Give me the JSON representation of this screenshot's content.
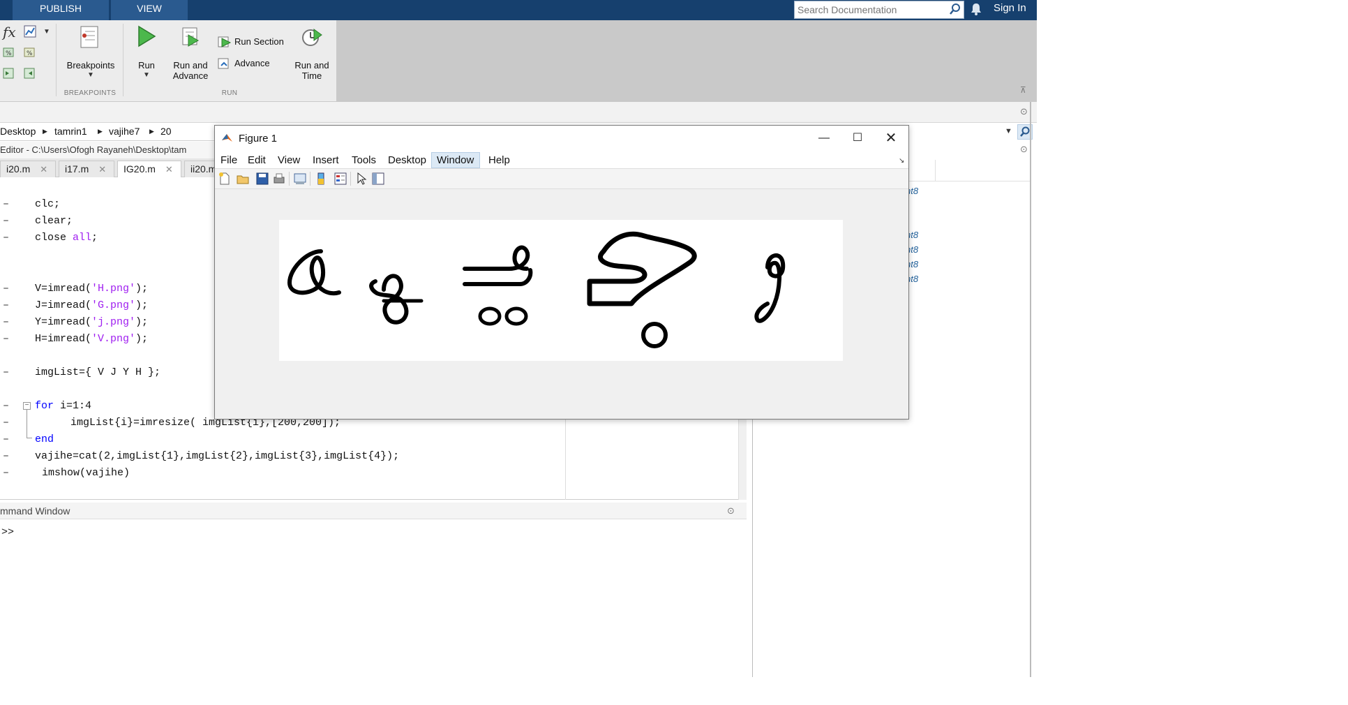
{
  "top_tabs": {
    "publish": "PUBLISH",
    "view": "VIEW"
  },
  "search": {
    "placeholder": "Search Documentation"
  },
  "header": {
    "sign_in": "Sign In"
  },
  "ribbon": {
    "breakpoints_label": "Breakpoints",
    "run_label": "Run",
    "run_and_advance_line1": "Run and",
    "run_and_advance_line2": "Advance",
    "run_section_label": "Run Section",
    "advance_label": "Advance",
    "run_and_time_line1": "Run and",
    "run_and_time_line2": "Time",
    "group_breakpoints": "BREAKPOINTS",
    "group_run": "RUN"
  },
  "breadcrumb": [
    "Desktop",
    "tamrin1",
    "vajihe7",
    "20"
  ],
  "editor": {
    "title": "Editor - C:\\Users\\Ofogh Rayaneh\\Desktop\\tam",
    "tabs": [
      {
        "label": "i20.m"
      },
      {
        "label": "i17.m"
      },
      {
        "label": "IG20.m"
      },
      {
        "label": "ii20.m"
      }
    ]
  },
  "code": {
    "l1": "clc;",
    "l2": "clear;",
    "l3a": "close ",
    "l3b": "all",
    "l3c": ";",
    "v1": "V=imread(",
    "v2": "'H.png'",
    "v3": ");",
    "j1": "J=imread(",
    "j2": "'G.png'",
    "j3": ");",
    "y1": "Y=imread(",
    "y2": "'j.png'",
    "y3": ");",
    "h1": "H=imread(",
    "h2": "'V.png'",
    "h3": ");",
    "list": "imgList={ V J Y H };",
    "for_kw": "for",
    "for_rest": " i=1:4",
    "resize": "imgList{i}=imresize( imgList{i},[200,200]);",
    "end_kw": "end",
    "cat": "vajihe=cat(2,imgList{1},imgList{2},imgList{3},imgList{4});",
    "show": "imshow(vajihe)"
  },
  "command_window": {
    "title": "mmand Window",
    "prompt": ">>"
  },
  "workspace_items": [
    "nt8",
    "nt8",
    "nt8",
    "nt8",
    "nt8"
  ],
  "figure": {
    "title": "Figure 1",
    "menu": [
      "File",
      "Edit",
      "View",
      "Insert",
      "Tools",
      "Desktop",
      "Window",
      "Help"
    ]
  }
}
